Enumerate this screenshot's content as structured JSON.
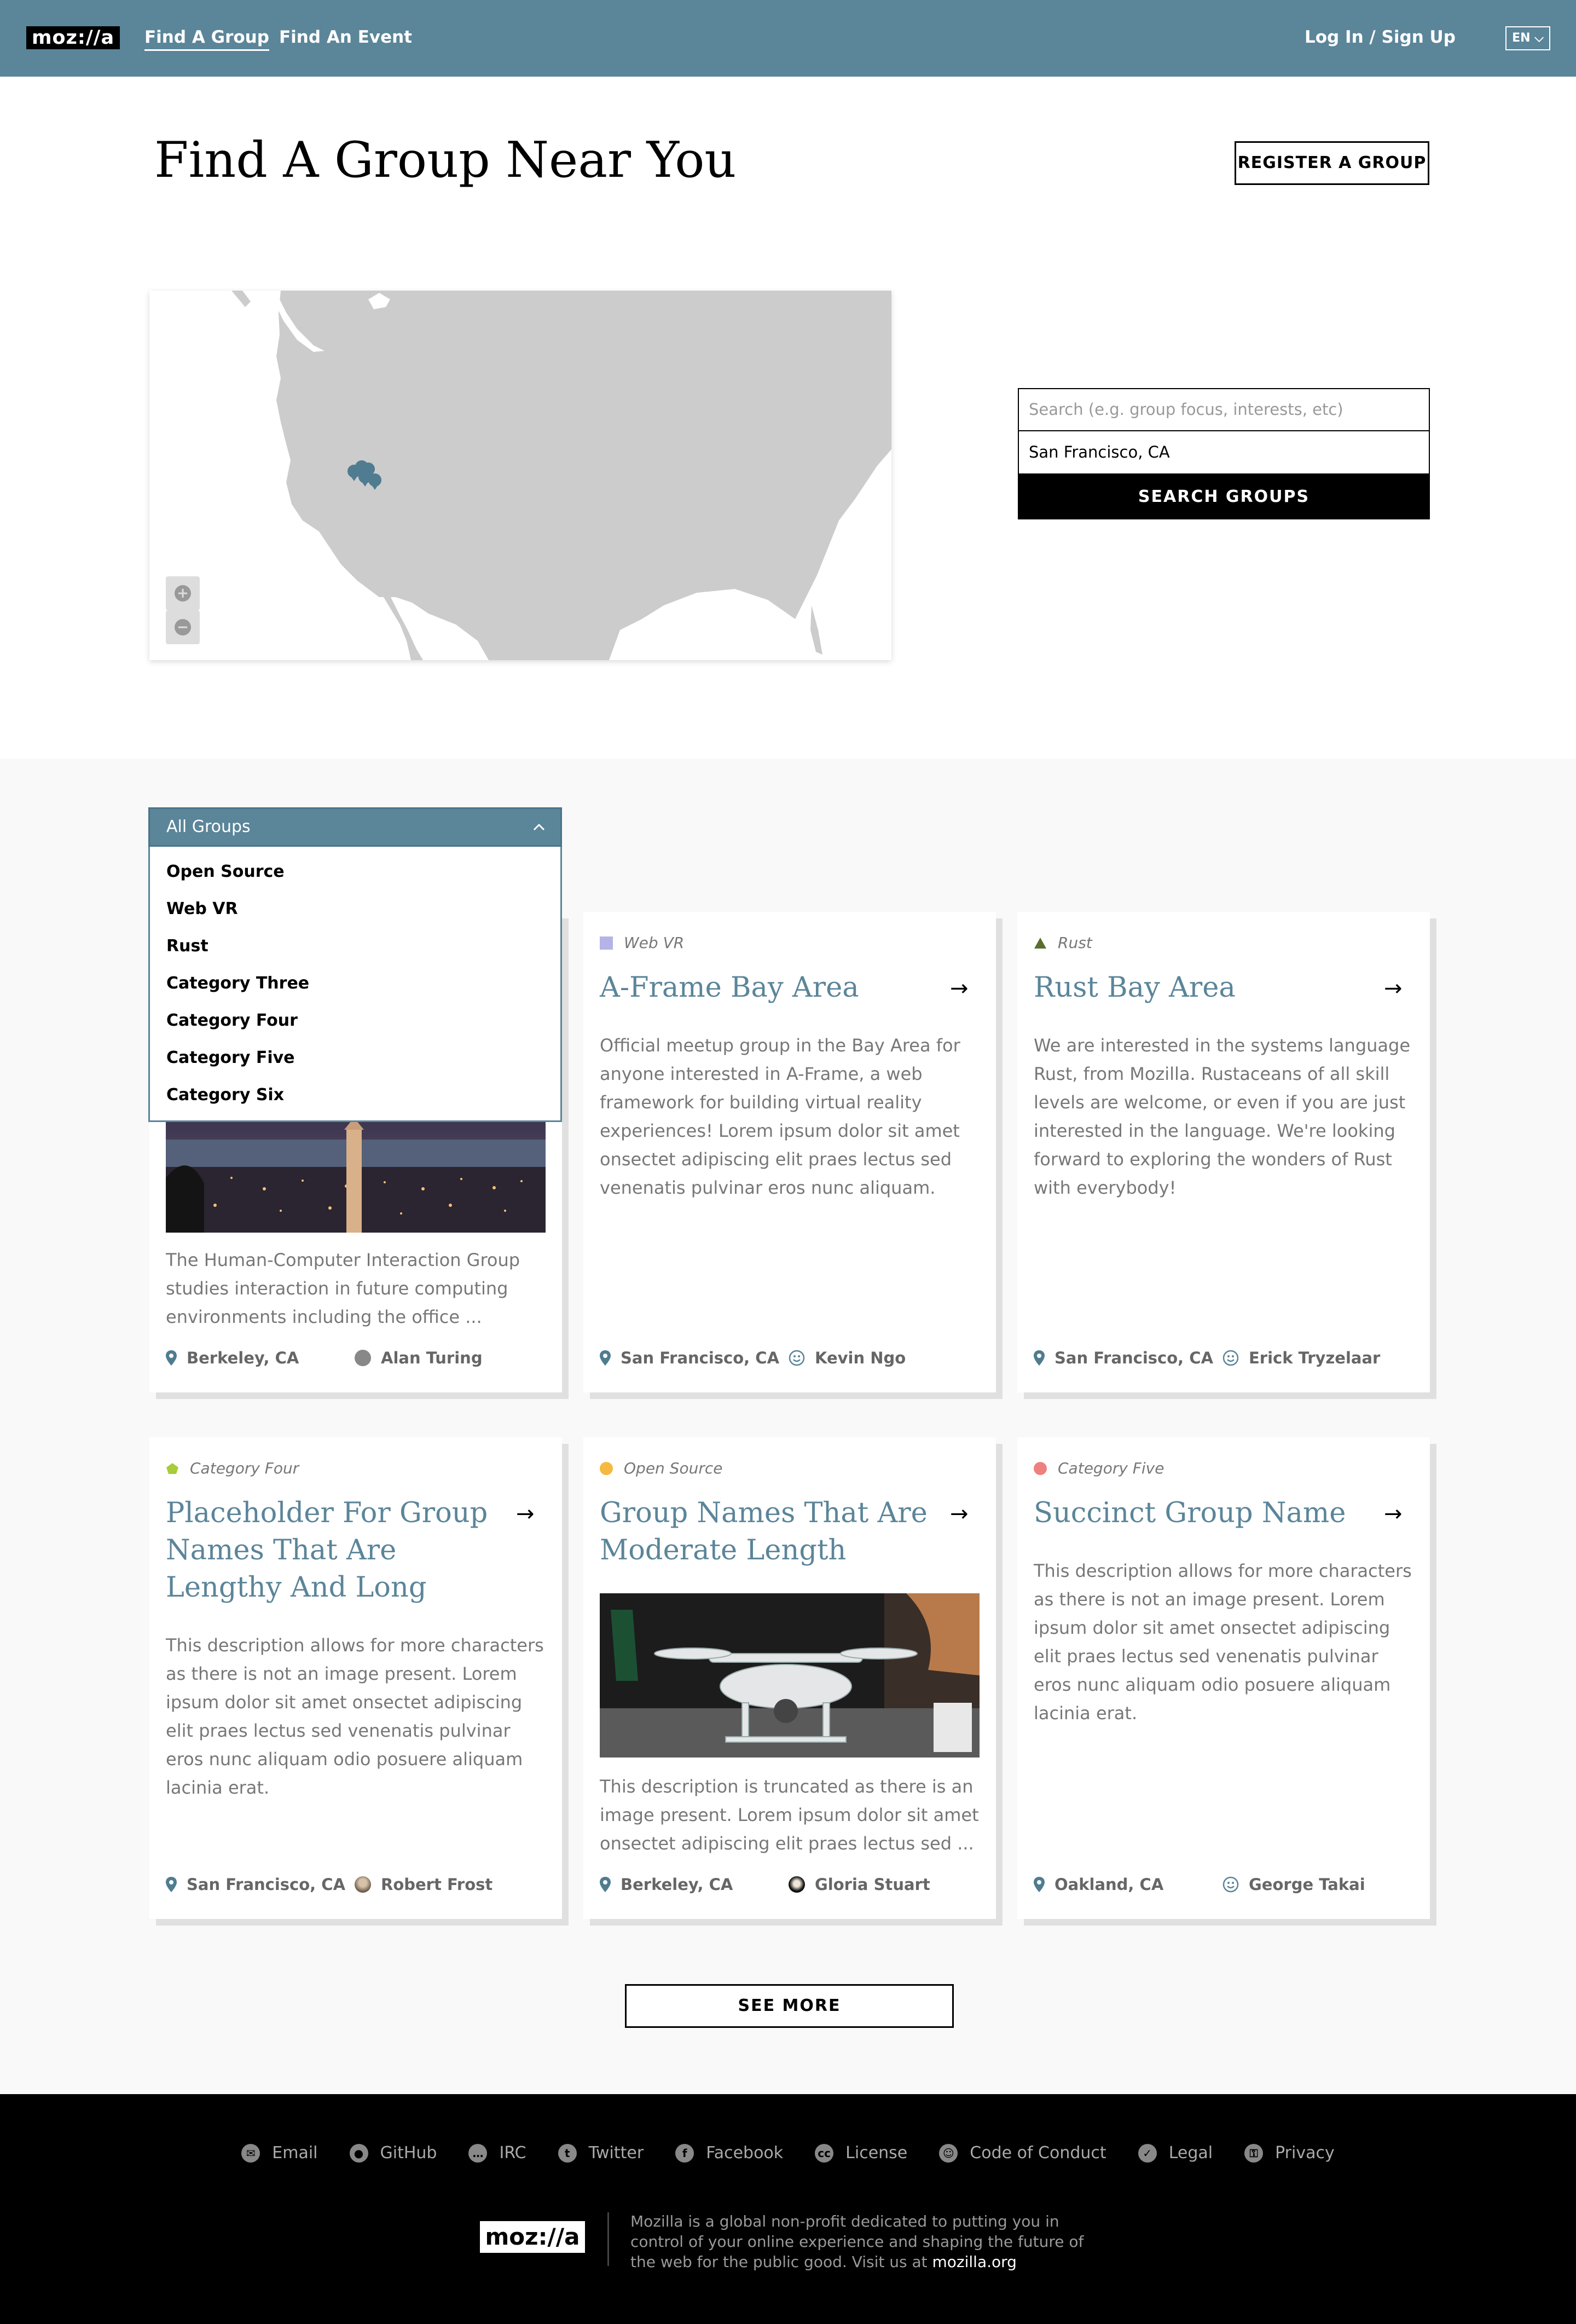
{
  "header": {
    "logo": "moz://a",
    "nav": [
      "Find A Group",
      "Find An Event"
    ],
    "login": "Log In / Sign Up",
    "lang": "EN"
  },
  "hero": {
    "title": "Find A Group Near You",
    "register_button": "REGISTER A GROUP"
  },
  "map": {
    "zoom_in": "+",
    "zoom_out": "−",
    "marker_icon": "map-pin-icon"
  },
  "search": {
    "placeholder": "Search (e.g. group focus, interests, etc)",
    "location": "San Francisco, CA",
    "button": "SEARCH GROUPS"
  },
  "filter": {
    "selected": "All Groups",
    "options": [
      "Open Source",
      "Web VR",
      "Rust",
      "Category Three",
      "Category Four",
      "Category Five",
      "Category Six"
    ]
  },
  "cards": [
    {
      "category": "Web VR",
      "title": "A-Frame Bay Area",
      "description": "Official meetup group in the Bay Area for anyone interested in A-Frame, a web framework for building virtual reality experiences! Lorem ipsum dolor sit amet onsectet adipiscing elit praes lectus sed venenatis pulvinar eros nunc aliquam.",
      "location": "San Francisco, CA",
      "owner": "Kevin Ngo"
    },
    {
      "category": "Rust",
      "title": "Rust Bay Area",
      "description": "We are interested in the systems language Rust, from Mozilla. Rustaceans of all skill levels are welcome, or even if you are just interested in the language. We're looking forward to exploring the wonders of Rust with everybody!",
      "location": "San Francisco, CA",
      "owner": "Erick Tryzelaar"
    },
    {
      "category": "",
      "title": "",
      "description": "The Human-Computer Interaction Group studies interaction in future computing environments including the office ...",
      "location": "Berkeley, CA",
      "owner": "Alan Turing"
    },
    {
      "category": "Category Four",
      "title": "Placeholder For Group Names That Are Lengthy And Long",
      "description": "This description allows for more characters as there is not an image present. Lorem ipsum dolor sit amet onsectet adipiscing elit praes lectus sed venenatis pulvinar eros nunc aliquam odio posuere aliquam lacinia erat.",
      "location": "San Francisco, CA",
      "owner": "Robert Frost"
    },
    {
      "category": "Open Source",
      "title": "Group Names That Are Moderate Length",
      "description": "This description is truncated as there is an image present. Lorem ipsum dolor sit amet onsectet adipiscing elit praes lectus sed ...",
      "location": "Berkeley, CA",
      "owner": "Gloria Stuart"
    },
    {
      "category": "Category Five",
      "title": "Succinct Group Name",
      "description": "This description allows for more characters as there is not an image present. Lorem ipsum dolor sit amet onsectet adipiscing elit praes lectus sed venenatis pulvinar eros nunc aliquam odio posuere aliquam lacinia erat.",
      "location": "Oakland, CA",
      "owner": "George Takai"
    }
  ],
  "see_more": "SEE MORE",
  "footer": {
    "links": [
      {
        "label": "Email",
        "icon": "email-icon"
      },
      {
        "label": "GitHub",
        "icon": "github-icon"
      },
      {
        "label": "IRC",
        "icon": "irc-icon"
      },
      {
        "label": "Twitter",
        "icon": "twitter-icon"
      },
      {
        "label": "Facebook",
        "icon": "facebook-icon"
      },
      {
        "label": "License",
        "icon": "license-icon"
      },
      {
        "label": "Code of Conduct",
        "icon": "conduct-icon"
      },
      {
        "label": "Legal",
        "icon": "legal-icon"
      },
      {
        "label": "Privacy",
        "icon": "privacy-icon"
      }
    ],
    "logo": "moz://a",
    "text": "Mozilla is a global non-profit dedicated to putting you in control of your online experience and shaping the future of the web for the public good. Visit us at",
    "link": "mozilla.org"
  },
  "colors": {
    "brand": "#5b8599",
    "webvr": "#b4b4e6",
    "rust": "#5a6e2e",
    "cat_four": "#a8cc3a",
    "open_source": "#f5b942",
    "cat_five": "#f08080"
  }
}
